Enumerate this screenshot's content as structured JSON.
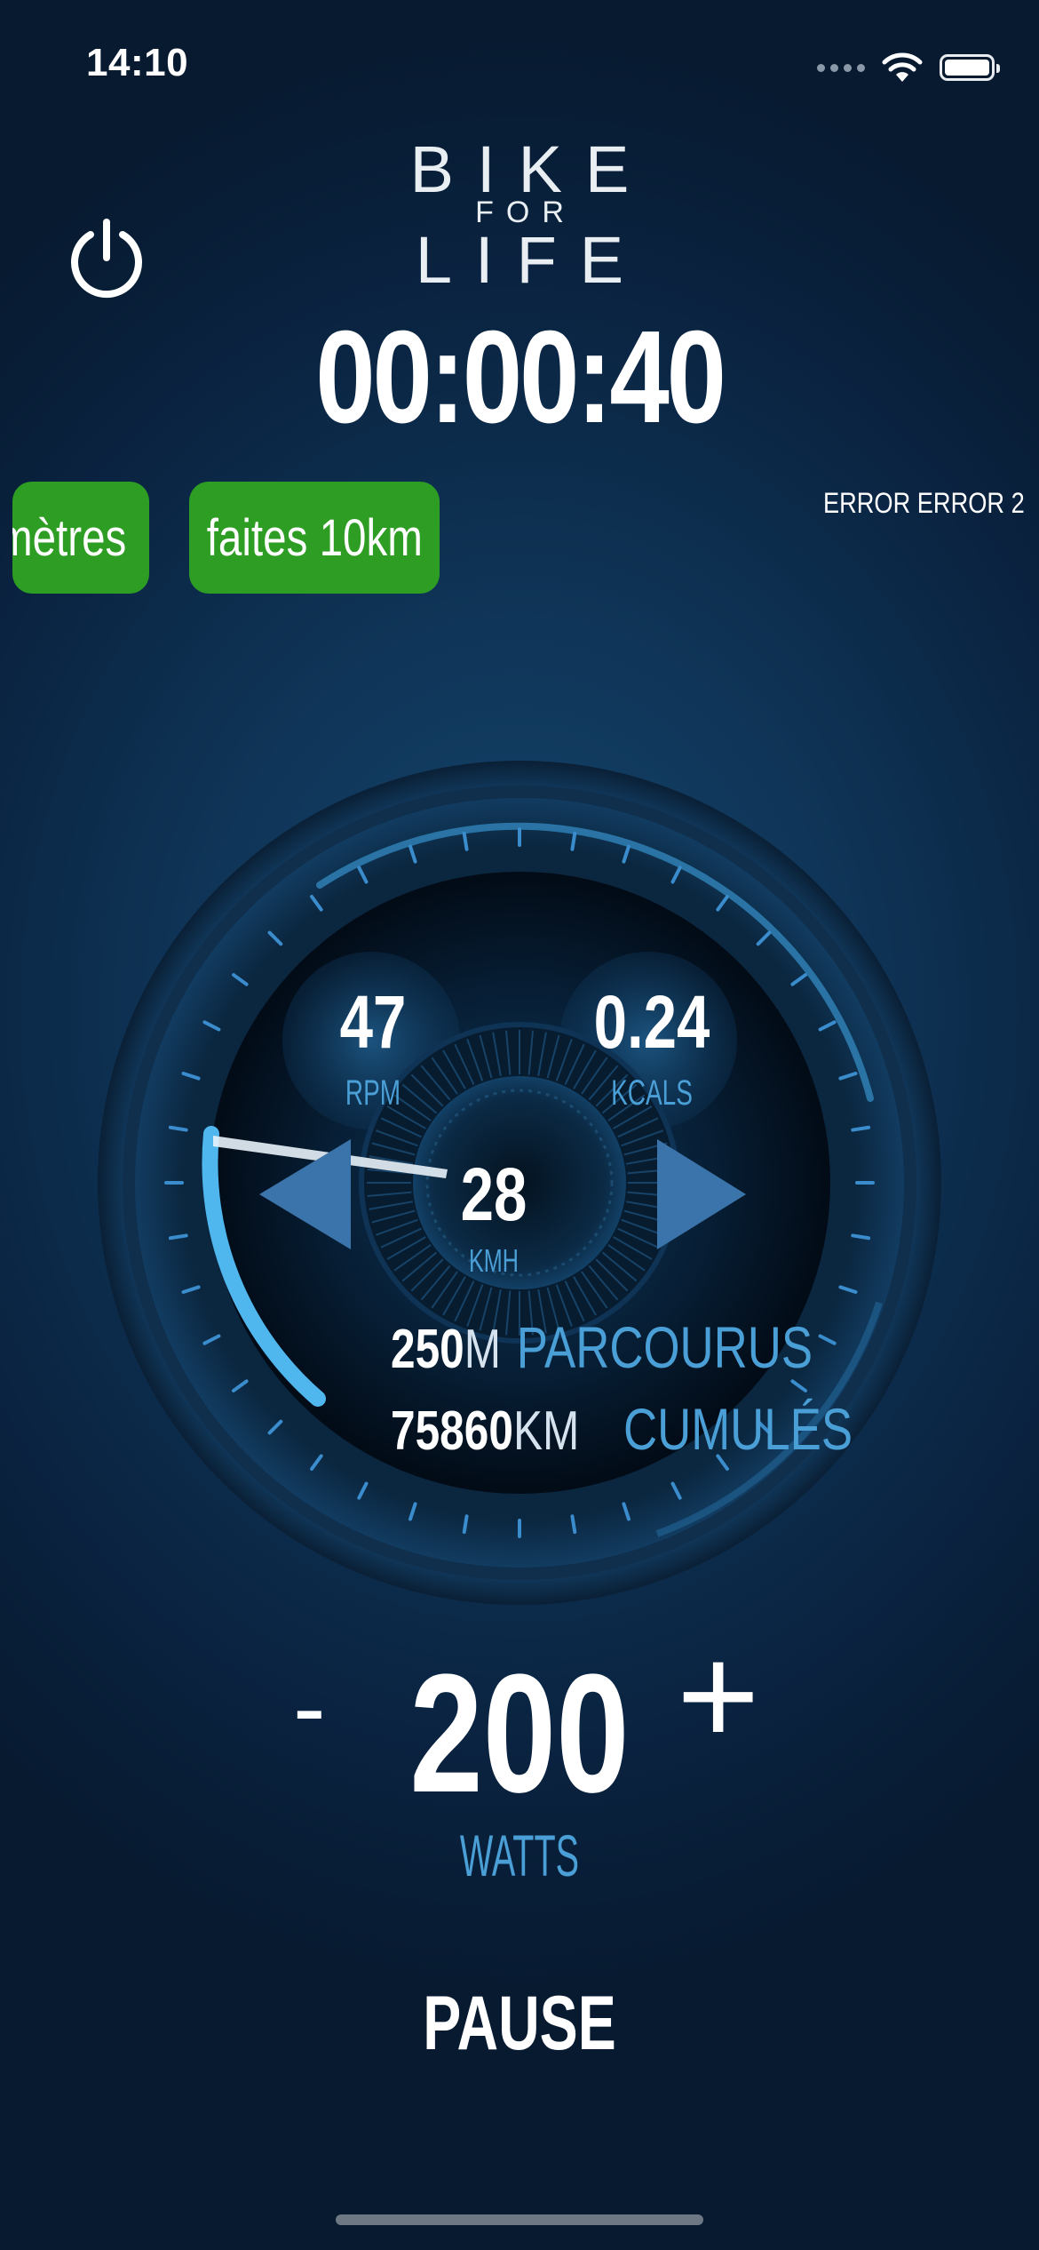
{
  "status_bar": {
    "time": "14:10",
    "icons": [
      "signal-dots-icon",
      "wifi-icon",
      "battery-icon"
    ]
  },
  "header": {
    "logo": {
      "line1": "BIKE",
      "line2": "FOR",
      "line3": "LIFE"
    },
    "power_icon": "power-icon",
    "timer": "00:00:40"
  },
  "challenges": [
    {
      "label": "mètres"
    },
    {
      "label": "faites 10km"
    }
  ],
  "error_message": "ERROR ERROR 2",
  "gauge": {
    "rpm": {
      "value": "47",
      "label": "RPM"
    },
    "kcals": {
      "value": "0.24",
      "label": "KCALS"
    },
    "speed": {
      "value": "28",
      "label": "KMH"
    },
    "left_arrow_icon": "left-arrow-icon",
    "right_arrow_icon": "right-arrow-icon",
    "distance": {
      "value": "250",
      "unit": "M",
      "label": "PARCOURUS"
    },
    "cumulative": {
      "value": "75860",
      "unit": "KM",
      "label": "CUMULÉS"
    }
  },
  "power": {
    "minus_label": "-",
    "value": "200",
    "plus_label": "+",
    "unit_label": "WATTS"
  },
  "pause_label": "PAUSE",
  "colors": {
    "background": "#0f3558",
    "accent_blue": "#4a9fd6",
    "challenge_green": "#2e9d23"
  }
}
